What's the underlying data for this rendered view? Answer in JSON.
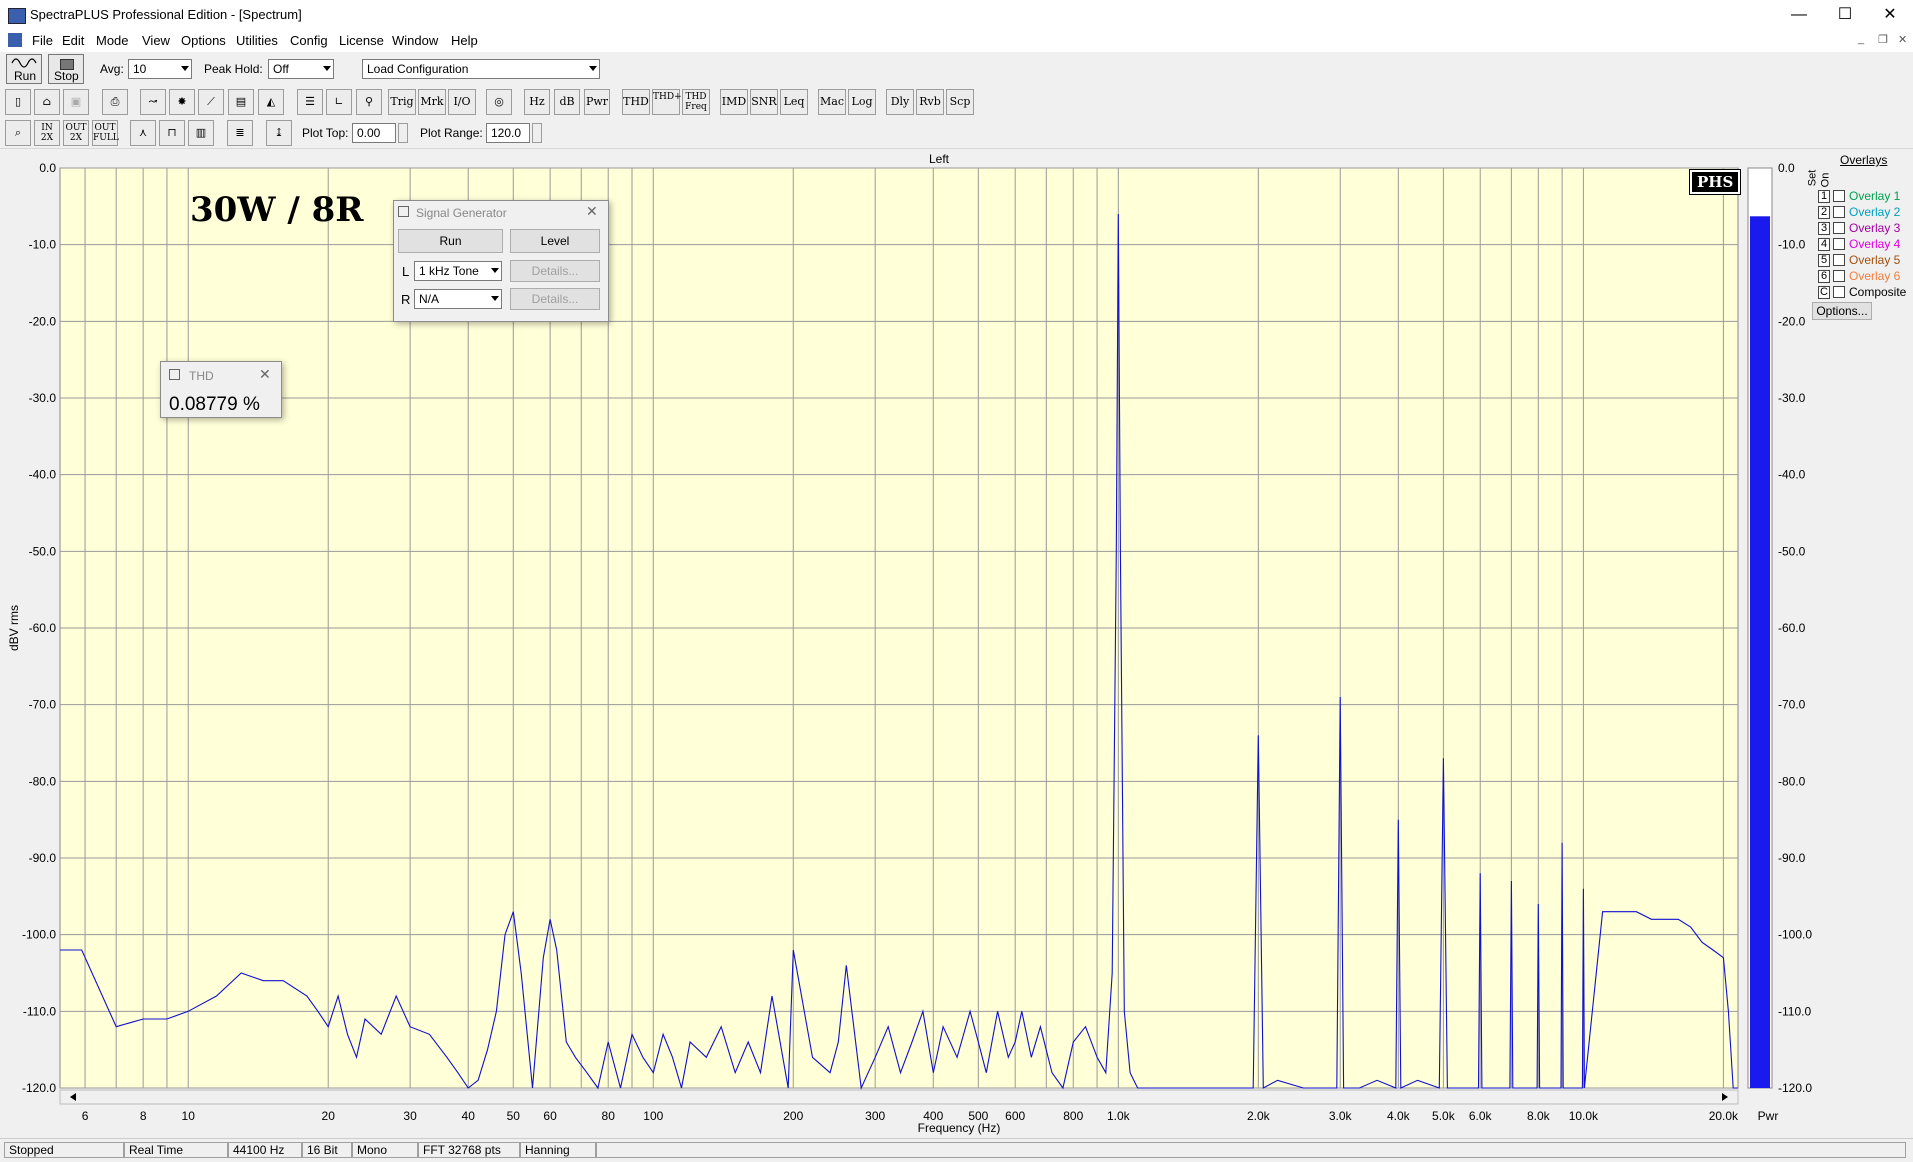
{
  "window": {
    "title": "SpectraPLUS Professional Edition - [Spectrum]",
    "minimize_glyph": "—",
    "maximize_glyph": "☐",
    "close_glyph": "✕"
  },
  "menu": [
    "File",
    "Edit",
    "Mode",
    "View",
    "Options",
    "Utilities",
    "Config",
    "License",
    "Window",
    "Help"
  ],
  "toolbar_top": {
    "run_label": "Run",
    "stop_label": "Stop",
    "avg_label": "Avg:",
    "avg_value": "10",
    "peak_hold_label": "Peak Hold:",
    "peak_hold_value": "Off",
    "config_value": "Load Configuration"
  },
  "toolbar_mid": {
    "text_buttons": [
      "Trig",
      "Mrk",
      "I/O",
      "Hz",
      "dB",
      "Pwr",
      "THD",
      "THD+N",
      "THD Freq",
      "IMD",
      "SNR",
      "Leq",
      "Mac",
      "Log",
      "Dly",
      "Rvb",
      "Scp"
    ]
  },
  "toolbar_bottom": {
    "plot_top_label": "Plot Top:",
    "plot_top_value": "0.00",
    "plot_range_label": "Plot Range:",
    "plot_range_value": "120.0"
  },
  "plot": {
    "channel_title": "Left",
    "annotation": "30W / 8R",
    "logo": "PHS",
    "pwr_label": "Pwr",
    "background": "#ffffd8",
    "trace_color": "#1010d0"
  },
  "chart_data": {
    "type": "line",
    "title": "Left",
    "xlabel": "Frequency (Hz)",
    "ylabel": "dBV rms",
    "xscale": "log",
    "xlim": [
      5.3,
      21500
    ],
    "ylim": [
      -120,
      0
    ],
    "x_tick_labels": [
      "6",
      "8",
      "10",
      "20",
      "30",
      "40",
      "50",
      "60",
      "80",
      "100",
      "200",
      "300",
      "400",
      "500",
      "600",
      "800",
      "1.0k",
      "2.0k",
      "3.0k",
      "4.0k",
      "5.0k",
      "6.0k",
      "8.0k",
      "10.0k",
      "20.0k"
    ],
    "x_tick_values": [
      6,
      8,
      10,
      20,
      30,
      40,
      50,
      60,
      80,
      100,
      200,
      300,
      400,
      500,
      600,
      800,
      1000,
      2000,
      3000,
      4000,
      5000,
      6000,
      8000,
      10000,
      20000
    ],
    "y_tick_labels": [
      "0.0",
      "-10.0",
      "-20.0",
      "-30.0",
      "-40.0",
      "-50.0",
      "-60.0",
      "-70.0",
      "-80.0",
      "-90.0",
      "-100.0",
      "-110.0",
      "-120.0"
    ],
    "y_tick_values": [
      0,
      -10,
      -20,
      -30,
      -40,
      -50,
      -60,
      -70,
      -80,
      -90,
      -100,
      -110,
      -120
    ],
    "grid": true,
    "series": [
      {
        "x": [
          5.3,
          5.9,
          7,
          8,
          9,
          10,
          11.5,
          13,
          14.5,
          16,
          18,
          19,
          20,
          21,
          22,
          23,
          24,
          26,
          28,
          30,
          33,
          36,
          38,
          40,
          42,
          44,
          46,
          48,
          50,
          52,
          55,
          58,
          60,
          62,
          65,
          68,
          72,
          76,
          80,
          85,
          90,
          95,
          100,
          105,
          110,
          115,
          120,
          130,
          140,
          150,
          160,
          170,
          180,
          195,
          200,
          220,
          240,
          250,
          260,
          280,
          300,
          320,
          340,
          360,
          380,
          400,
          420,
          450,
          480,
          500,
          520,
          550,
          580,
          600,
          620,
          650,
          680,
          720,
          760,
          800,
          850,
          900,
          940,
          970,
          990,
          1000,
          1010,
          1030,
          1060,
          1100,
          1200,
          1400,
          1600,
          1800,
          1950,
          2000,
          2050,
          2200,
          2500,
          2800,
          2950,
          3000,
          3050,
          3300,
          3600,
          3950,
          4000,
          4050,
          4400,
          4900,
          5000,
          5100,
          5500,
          5950,
          6000,
          6050,
          6500,
          6950,
          7000,
          7050,
          7500,
          7950,
          8000,
          8050,
          8500,
          8950,
          9000,
          9050,
          9500,
          9950,
          10000,
          10050,
          11000,
          12000,
          13000,
          14000,
          15000,
          16000,
          17000,
          18000,
          19000,
          20000,
          20500,
          21000,
          21500
        ],
        "y": [
          -102,
          -102,
          -112,
          -111,
          -111,
          -110,
          -108,
          -105,
          -106,
          -106,
          -108,
          -110,
          -112,
          -108,
          -113,
          -116,
          -111,
          -113,
          -108,
          -112,
          -113,
          -116,
          -118,
          -120,
          -119,
          -115,
          -110,
          -100,
          -97,
          -105,
          -120,
          -103,
          -98,
          -102,
          -114,
          -116,
          -118,
          -120,
          -114,
          -120,
          -113,
          -116,
          -118,
          -113,
          -116,
          -120,
          -114,
          -116,
          -112,
          -118,
          -114,
          -118,
          -108,
          -120,
          -102,
          -116,
          -118,
          -114,
          -104,
          -120,
          -116,
          -112,
          -118,
          -114,
          -110,
          -118,
          -112,
          -116,
          -110,
          -114,
          -118,
          -110,
          -116,
          -114,
          -110,
          -116,
          -112,
          -118,
          -120,
          -114,
          -112,
          -116,
          -118,
          -105,
          -50,
          -6,
          -50,
          -110,
          -118,
          -120,
          -120,
          -120,
          -120,
          -120,
          -120,
          -74,
          -120,
          -119,
          -120,
          -120,
          -120,
          -69,
          -120,
          -120,
          -119,
          -120,
          -85,
          -120,
          -119,
          -120,
          -77,
          -120,
          -120,
          -120,
          -92,
          -120,
          -120,
          -120,
          -93,
          -120,
          -120,
          -120,
          -96,
          -120,
          -120,
          -120,
          -88,
          -120,
          -120,
          -120,
          -94,
          -120,
          -97,
          -97,
          -97,
          -98,
          -98,
          -98,
          -99,
          -101,
          -102,
          -103,
          -110,
          -120,
          -120
        ]
      }
    ],
    "level_meter": {
      "label": "Pwr",
      "value": -6.3,
      "ylim": [
        -120,
        0
      ],
      "tick_labels": [
        "0.0",
        "-10.0",
        "-20.0",
        "-30.0",
        "-40.0",
        "-50.0",
        "-60.0",
        "-70.0",
        "-80.0",
        "-90.0",
        "-100.0",
        "-110.0",
        "-120.0"
      ]
    }
  },
  "signal_generator": {
    "title": "Signal Generator",
    "run_label": "Run",
    "level_label": "Level",
    "left_channel_label": "L",
    "left_value": "1 kHz Tone",
    "right_channel_label": "R",
    "right_value": "N/A",
    "details_label": "Details..."
  },
  "thd_window": {
    "title": "THD",
    "value": "0.08779 %"
  },
  "overlays": {
    "title": "Overlays",
    "set_header": "Set",
    "on_header": "On",
    "items": [
      {
        "num": "1",
        "label": "Overlay 1",
        "color": "#00a050"
      },
      {
        "num": "2",
        "label": "Overlay 2",
        "color": "#00a0c0"
      },
      {
        "num": "3",
        "label": "Overlay 3",
        "color": "#a000a0"
      },
      {
        "num": "4",
        "label": "Overlay 4",
        "color": "#e000e0"
      },
      {
        "num": "5",
        "label": "Overlay 5",
        "color": "#a05010"
      },
      {
        "num": "6",
        "label": "Overlay 6",
        "color": "#f08040"
      },
      {
        "num": "C",
        "label": "Composite",
        "color": "#000000"
      }
    ],
    "options_label": "Options..."
  },
  "status": [
    "Stopped",
    "Real Time",
    "44100 Hz",
    "16 Bit",
    "Mono",
    "FFT 32768 pts",
    "Hanning"
  ]
}
